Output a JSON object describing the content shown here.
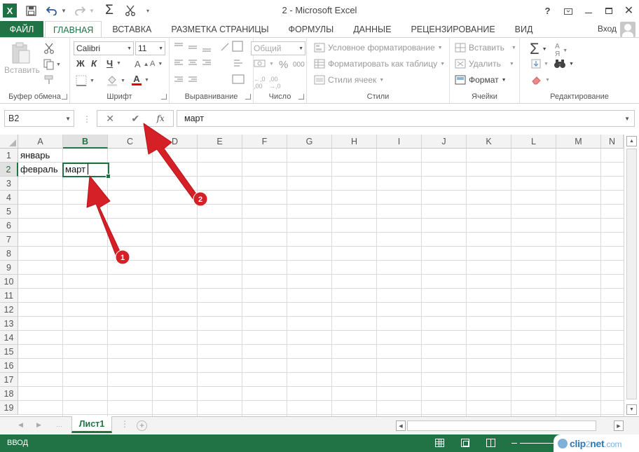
{
  "window": {
    "title": "2 - Microsoft Excel",
    "help": "?",
    "controls": [
      "restore-icon",
      "minimize-icon",
      "maximize-icon",
      "close-icon"
    ]
  },
  "qat": {
    "logo": "X",
    "icons": [
      "save-icon",
      "undo-icon",
      "redo-icon",
      "autosum-icon",
      "cut-icon"
    ]
  },
  "tabs": {
    "file": "ФАЙЛ",
    "items": [
      "ГЛАВНАЯ",
      "ВСТАВКА",
      "РАЗМЕТКА СТРАНИЦЫ",
      "ФОРМУЛЫ",
      "ДАННЫЕ",
      "РЕЦЕНЗИРОВАНИЕ",
      "ВИД"
    ],
    "active": "ГЛАВНАЯ",
    "signin": "Вход"
  },
  "ribbon": {
    "clipboard": {
      "label": "Буфер обмена",
      "paste": "Вставить"
    },
    "font": {
      "label": "Шрифт",
      "family": "Calibri",
      "size": "11",
      "bold": "Ж",
      "italic": "К",
      "underline": "Ч"
    },
    "alignment": {
      "label": "Выравнивание"
    },
    "number": {
      "label": "Число",
      "format": "Общий",
      "percent": "%",
      "thousands": "000"
    },
    "styles": {
      "label": "Стили",
      "conditional": "Условное форматирование",
      "as_table": "Форматировать как таблицу",
      "cell_styles": "Стили ячеек"
    },
    "cells": {
      "label": "Ячейки",
      "insert": "Вставить",
      "delete": "Удалить",
      "format": "Формат"
    },
    "editing": {
      "label": "Редактирование",
      "sum": "Σ"
    }
  },
  "formula_bar": {
    "name_box": "B2",
    "cancel": "✕",
    "enter": "✔",
    "fx": "fx",
    "content": "март"
  },
  "sheet": {
    "columns": [
      "A",
      "B",
      "C",
      "D",
      "E",
      "F",
      "G",
      "H",
      "I",
      "J",
      "K",
      "L",
      "M",
      "N"
    ],
    "rows": [
      "1",
      "2",
      "3",
      "4",
      "5",
      "6",
      "7",
      "8",
      "9",
      "10",
      "11",
      "12",
      "13",
      "14",
      "15",
      "16",
      "17",
      "18",
      "19"
    ],
    "selected_column": "B",
    "selected_row": "2",
    "cells": {
      "A1": "январь",
      "A2": "февраль",
      "B2": "март"
    }
  },
  "sheet_tabs": {
    "tabs": [
      "Лист1"
    ],
    "active": "Лист1",
    "add": "+"
  },
  "status_bar": {
    "mode": "ВВОД"
  },
  "annotations": {
    "arrow1": "1",
    "arrow2": "2",
    "color": "#d62027"
  },
  "watermark": {
    "text_a": "clip",
    "text_b": "2",
    "text_c": "net",
    "text_d": ".com"
  }
}
